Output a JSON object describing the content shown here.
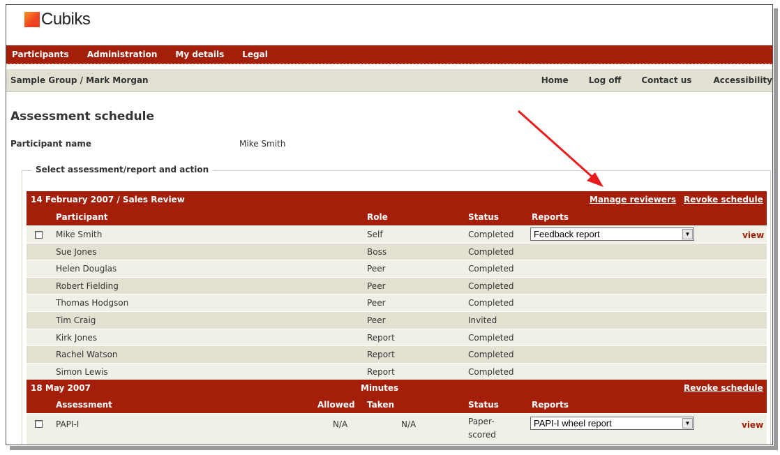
{
  "logo": {
    "text": "Cubiks"
  },
  "topnav": [
    "Participants",
    "Administration",
    "My details",
    "Legal"
  ],
  "subnav": {
    "breadcrumb": "Sample Group / Mark Morgan",
    "links": [
      "Home",
      "Log off",
      "Contact us",
      "Accessibility"
    ]
  },
  "page": {
    "title": "Assessment schedule",
    "participant_label": "Participant name",
    "participant_value": "Mike Smith",
    "legend": "Select assessment/report and action"
  },
  "schedule1": {
    "header": "14 February 2007 / Sales Review",
    "manage_reviewers": "Manage reviewers",
    "revoke": "Revoke schedule",
    "columns": {
      "participant": "Participant",
      "role": "Role",
      "status": "Status",
      "reports": "Reports"
    },
    "rows": [
      {
        "name": "Mike Smith",
        "role": "Self",
        "status": "Completed",
        "report": "Feedback report",
        "view": "view"
      },
      {
        "name": "Sue Jones",
        "role": "Boss",
        "status": "Completed"
      },
      {
        "name": "Helen Douglas",
        "role": "Peer",
        "status": "Completed"
      },
      {
        "name": "Robert Fielding",
        "role": "Peer",
        "status": "Completed"
      },
      {
        "name": "Thomas Hodgson",
        "role": "Peer",
        "status": "Completed"
      },
      {
        "name": "Tim Craig",
        "role": "Peer",
        "status": "Invited"
      },
      {
        "name": "Kirk Jones",
        "role": "Report",
        "status": "Completed"
      },
      {
        "name": "Rachel Watson",
        "role": "Report",
        "status": "Completed"
      },
      {
        "name": "Simon Lewis",
        "role": "Report",
        "status": "Completed"
      }
    ]
  },
  "schedule2": {
    "header": "18 May 2007",
    "minutes": "Minutes",
    "revoke": "Revoke schedule",
    "columns": {
      "assessment": "Assessment",
      "allowed": "Allowed",
      "taken": "Taken",
      "status": "Status",
      "reports": "Reports"
    },
    "rows": [
      {
        "name": "PAPI-I",
        "allowed": "N/A",
        "taken": "N/A",
        "status_line1": "Paper-",
        "status_line2": "scored",
        "report": "PAPI-I wheel report",
        "view": "view"
      }
    ]
  },
  "colors": {
    "brand_red": "#a41f0a",
    "row_light": "#f1f0e6",
    "row_dark": "#e3e1d2",
    "annotation_arrow": "#e81c1c"
  },
  "icons": [
    "checkbox",
    "dropdown-arrow-icon",
    "annotation-arrow"
  ]
}
